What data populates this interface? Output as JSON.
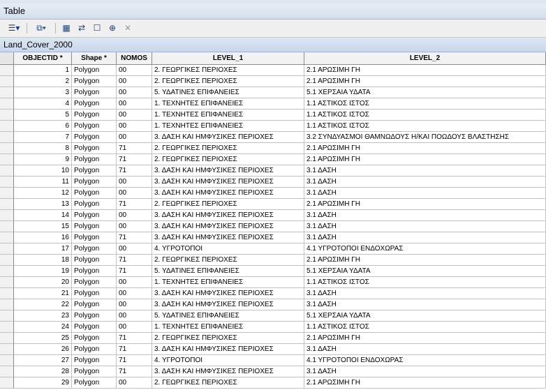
{
  "window": {
    "title": "Table"
  },
  "toolbar": {
    "buttons": [
      {
        "name": "table-options-icon",
        "glyph": "☰▾"
      },
      {
        "name": "related-tables-icon",
        "glyph": "⧉▾"
      },
      {
        "name": "select-by-attributes-icon",
        "glyph": "▦"
      },
      {
        "name": "switch-selection-icon",
        "glyph": "⇄"
      },
      {
        "name": "clear-selection-icon",
        "glyph": "☐"
      },
      {
        "name": "zoom-to-selected-icon",
        "glyph": "⊕"
      },
      {
        "name": "delete-selected-icon",
        "glyph": "✕"
      }
    ]
  },
  "tab": {
    "label": "Land_Cover_2000"
  },
  "table": {
    "columns": [
      "OBJECTID *",
      "Shape *",
      "NOMOS",
      "LEVEL_1",
      "LEVEL_2"
    ],
    "rows": [
      [
        "1",
        "Polygon",
        "00",
        "2. ΓΕΩΡΓΙΚΕΣ ΠΕΡΙΟΧΕΣ",
        "2.1 ΑΡΩΣΙΜΗ ΓΗ"
      ],
      [
        "2",
        "Polygon",
        "00",
        "2. ΓΕΩΡΓΙΚΕΣ ΠΕΡΙΟΧΕΣ",
        "2.1 ΑΡΩΣΙΜΗ ΓΗ"
      ],
      [
        "3",
        "Polygon",
        "00",
        "5. ΥΔΑΤΙΝΕΣ ΕΠΙΦΑΝΕΙΕΣ",
        "5.1 ΧΕΡΣΑΙΑ ΥΔΑΤΑ"
      ],
      [
        "4",
        "Polygon",
        "00",
        "1. ΤΕΧΝΗΤΕΣ ΕΠΙΦΑΝΕΙΕΣ",
        "1.1 ΑΣΤΙΚΟΣ ΙΣΤΟΣ"
      ],
      [
        "5",
        "Polygon",
        "00",
        "1. ΤΕΧΝΗΤΕΣ ΕΠΙΦΑΝΕΙΕΣ",
        "1.1 ΑΣΤΙΚΟΣ ΙΣΤΟΣ"
      ],
      [
        "6",
        "Polygon",
        "00",
        "1. ΤΕΧΝΗΤΕΣ ΕΠΙΦΑΝΕΙΕΣ",
        "1.1 ΑΣΤΙΚΟΣ ΙΣΤΟΣ"
      ],
      [
        "7",
        "Polygon",
        "00",
        "3. ΔΑΣΗ ΚΑΙ ΗΜΦΥΣΙΚΕΣ ΠΕΡΙΟΧΕΣ",
        "3.2 ΣΥΝΔΥΑΣΜΟΙ ΘΑΜΝΩΔΟΥΣ Η/ΚΑΙ ΠΟΩΔΟΥΣ ΒΛΑΣΤΗΣΗΣ"
      ],
      [
        "8",
        "Polygon",
        "71",
        "2. ΓΕΩΡΓΙΚΕΣ ΠΕΡΙΟΧΕΣ",
        "2.1 ΑΡΩΣΙΜΗ ΓΗ"
      ],
      [
        "9",
        "Polygon",
        "71",
        "2. ΓΕΩΡΓΙΚΕΣ ΠΕΡΙΟΧΕΣ",
        "2.1 ΑΡΩΣΙΜΗ ΓΗ"
      ],
      [
        "10",
        "Polygon",
        "71",
        "3. ΔΑΣΗ ΚΑΙ ΗΜΦΥΣΙΚΕΣ ΠΕΡΙΟΧΕΣ",
        "3.1 ΔΑΣΗ"
      ],
      [
        "11",
        "Polygon",
        "00",
        "3. ΔΑΣΗ ΚΑΙ ΗΜΦΥΣΙΚΕΣ ΠΕΡΙΟΧΕΣ",
        "3.1 ΔΑΣΗ"
      ],
      [
        "12",
        "Polygon",
        "00",
        "3. ΔΑΣΗ ΚΑΙ ΗΜΦΥΣΙΚΕΣ ΠΕΡΙΟΧΕΣ",
        "3.1 ΔΑΣΗ"
      ],
      [
        "13",
        "Polygon",
        "71",
        "2. ΓΕΩΡΓΙΚΕΣ ΠΕΡΙΟΧΕΣ",
        "2.1 ΑΡΩΣΙΜΗ ΓΗ"
      ],
      [
        "14",
        "Polygon",
        "00",
        "3. ΔΑΣΗ ΚΑΙ ΗΜΦΥΣΙΚΕΣ ΠΕΡΙΟΧΕΣ",
        "3.1 ΔΑΣΗ"
      ],
      [
        "15",
        "Polygon",
        "00",
        "3. ΔΑΣΗ ΚΑΙ ΗΜΦΥΣΙΚΕΣ ΠΕΡΙΟΧΕΣ",
        "3.1 ΔΑΣΗ"
      ],
      [
        "16",
        "Polygon",
        "71",
        "3. ΔΑΣΗ ΚΑΙ ΗΜΦΥΣΙΚΕΣ ΠΕΡΙΟΧΕΣ",
        "3.1 ΔΑΣΗ"
      ],
      [
        "17",
        "Polygon",
        "00",
        "4. ΥΓΡΟΤΟΠΟΙ",
        "4.1 ΥΓΡΟΤΟΠΟΙ ΕΝΔΟΧΩΡΑΣ"
      ],
      [
        "18",
        "Polygon",
        "71",
        "2. ΓΕΩΡΓΙΚΕΣ ΠΕΡΙΟΧΕΣ",
        "2.1 ΑΡΩΣΙΜΗ ΓΗ"
      ],
      [
        "19",
        "Polygon",
        "71",
        "5. ΥΔΑΤΙΝΕΣ ΕΠΙΦΑΝΕΙΕΣ",
        "5.1 ΧΕΡΣΑΙΑ ΥΔΑΤΑ"
      ],
      [
        "20",
        "Polygon",
        "00",
        "1. ΤΕΧΝΗΤΕΣ ΕΠΙΦΑΝΕΙΕΣ",
        "1.1 ΑΣΤΙΚΟΣ ΙΣΤΟΣ"
      ],
      [
        "21",
        "Polygon",
        "00",
        "3. ΔΑΣΗ ΚΑΙ ΗΜΦΥΣΙΚΕΣ ΠΕΡΙΟΧΕΣ",
        "3.1 ΔΑΣΗ"
      ],
      [
        "22",
        "Polygon",
        "00",
        "3. ΔΑΣΗ ΚΑΙ ΗΜΦΥΣΙΚΕΣ ΠΕΡΙΟΧΕΣ",
        "3.1 ΔΑΣΗ"
      ],
      [
        "23",
        "Polygon",
        "00",
        "5. ΥΔΑΤΙΝΕΣ ΕΠΙΦΑΝΕΙΕΣ",
        "5.1 ΧΕΡΣΑΙΑ ΥΔΑΤΑ"
      ],
      [
        "24",
        "Polygon",
        "00",
        "1. ΤΕΧΝΗΤΕΣ ΕΠΙΦΑΝΕΙΕΣ",
        "1.1 ΑΣΤΙΚΟΣ ΙΣΤΟΣ"
      ],
      [
        "25",
        "Polygon",
        "71",
        "2. ΓΕΩΡΓΙΚΕΣ ΠΕΡΙΟΧΕΣ",
        "2.1 ΑΡΩΣΙΜΗ ΓΗ"
      ],
      [
        "26",
        "Polygon",
        "71",
        "3. ΔΑΣΗ ΚΑΙ ΗΜΦΥΣΙΚΕΣ ΠΕΡΙΟΧΕΣ",
        "3.1 ΔΑΣΗ"
      ],
      [
        "27",
        "Polygon",
        "71",
        "4. ΥΓΡΟΤΟΠΟΙ",
        "4.1 ΥΓΡΟΤΟΠΟΙ ΕΝΔΟΧΩΡΑΣ"
      ],
      [
        "28",
        "Polygon",
        "71",
        "3. ΔΑΣΗ ΚΑΙ ΗΜΦΥΣΙΚΕΣ ΠΕΡΙΟΧΕΣ",
        "3.1 ΔΑΣΗ"
      ],
      [
        "29",
        "Polygon",
        "00",
        "2. ΓΕΩΡΓΙΚΕΣ ΠΕΡΙΟΧΕΣ",
        "2.1 ΑΡΩΣΙΜΗ ΓΗ"
      ]
    ]
  }
}
